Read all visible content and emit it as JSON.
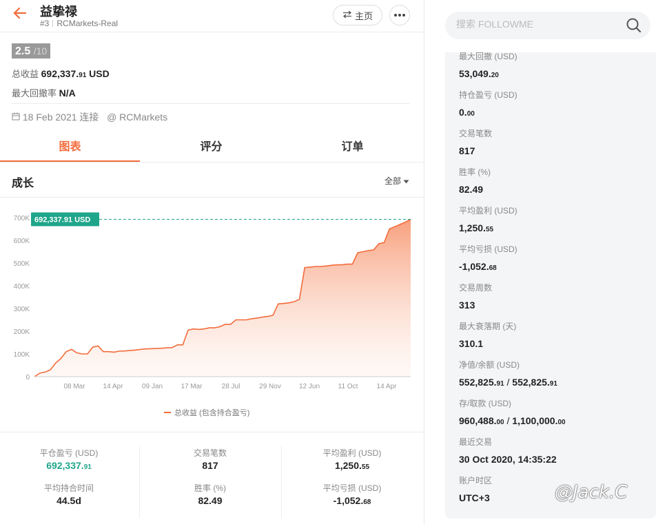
{
  "header": {
    "back_icon": "arrow-left-icon",
    "trader_name": "益挚禄",
    "rank": "#3",
    "broker_account": "RCMarkets-Real",
    "home_button": "主页",
    "more_icon": "ellipsis-icon"
  },
  "summary": {
    "score": "2.5",
    "score_denominator": "/10",
    "total_profit_label": "总收益",
    "total_profit_int": "692,337.",
    "total_profit_dec": "91",
    "total_profit_unit": "USD",
    "max_drawdown_label": "最大回撤率",
    "max_drawdown_value": "N/A",
    "connected_date": "18 Feb 2021 连接",
    "connected_broker": "@ RCMarkets"
  },
  "tabs": [
    {
      "label": "图表",
      "active": true
    },
    {
      "label": "评分",
      "active": false
    },
    {
      "label": "订单",
      "active": false
    }
  ],
  "growth": {
    "title": "成长",
    "range": "全部"
  },
  "chart_data": {
    "type": "area",
    "title": "",
    "xlabel": "",
    "ylabel": "",
    "ylim": [
      0,
      700000
    ],
    "yticks": [
      "0",
      "100K",
      "200K",
      "300K",
      "400K",
      "500K",
      "600K",
      "700K"
    ],
    "xticks": [
      "08 Mar",
      "14 Apr",
      "09 Jan",
      "17 Mar",
      "28 Jul",
      "29 Nov",
      "12 Jun",
      "11 Oct",
      "14 Apr"
    ],
    "current_label": "692,337.91 USD",
    "series": [
      {
        "name": "总收益 (包含持合盈亏)",
        "color": "#f26b3a",
        "values": [
          0,
          15000,
          20000,
          30000,
          60000,
          80000,
          110000,
          120000,
          105000,
          100000,
          100000,
          130000,
          135000,
          110000,
          110000,
          108000,
          112000,
          113000,
          115000,
          117000,
          120000,
          122000,
          123000,
          124000,
          125000,
          127000,
          128000,
          140000,
          140000,
          205000,
          210000,
          208000,
          210000,
          215000,
          215000,
          220000,
          230000,
          230000,
          250000,
          250000,
          250000,
          255000,
          258000,
          262000,
          265000,
          270000,
          320000,
          322000,
          325000,
          330000,
          340000,
          480000,
          482000,
          485000,
          485000,
          487000,
          490000,
          492000,
          492000,
          495000,
          495000,
          545000,
          550000,
          555000,
          558000,
          585000,
          590000,
          650000,
          660000,
          670000,
          680000,
          692338
        ]
      }
    ],
    "legend": "bottom-center",
    "grid": false
  },
  "bottom_stats": [
    {
      "label": "平仓盈亏 (USD)",
      "int": "692,337.",
      "dec": "91",
      "green": true
    },
    {
      "label": "交易笔数",
      "int": "817",
      "dec": "",
      "green": false
    },
    {
      "label": "平均盈利 (USD)",
      "int": "1,250.",
      "dec": "55",
      "green": false
    },
    {
      "label": "平均持合时间",
      "int": "44.5d",
      "dec": "",
      "green": false
    },
    {
      "label": "胜率 (%)",
      "int": "82.49",
      "dec": "",
      "green": false
    },
    {
      "label": "平均亏损 (USD)",
      "int": "-1,052.",
      "dec": "68",
      "green": false
    }
  ],
  "search": {
    "placeholder": "搜索 FOLLOWME",
    "icon": "search-icon"
  },
  "right_panel": [
    {
      "label": "最大回撤 (USD)",
      "int": "53,049.",
      "dec": "20",
      "int2": "",
      "dec2": ""
    },
    {
      "label": "持仓盈亏 (USD)",
      "int": "0.",
      "dec": "00",
      "int2": "",
      "dec2": ""
    },
    {
      "label": "交易笔数",
      "int": "817",
      "dec": "",
      "int2": "",
      "dec2": ""
    },
    {
      "label": "胜率 (%)",
      "int": "82.49",
      "dec": "",
      "int2": "",
      "dec2": ""
    },
    {
      "label": "平均盈利 (USD)",
      "int": "1,250.",
      "dec": "55",
      "int2": "",
      "dec2": ""
    },
    {
      "label": "平均亏损 (USD)",
      "int": "-1,052.",
      "dec": "68",
      "int2": "",
      "dec2": ""
    },
    {
      "label": "交易周数",
      "int": "313",
      "dec": "",
      "int2": "",
      "dec2": ""
    },
    {
      "label": "最大衰落期 (天)",
      "int": "310.1",
      "dec": "",
      "int2": "",
      "dec2": ""
    },
    {
      "label": "净值/余额 (USD)",
      "int": "552,825.",
      "dec": "91",
      "int2": "552,825.",
      "dec2": "91"
    },
    {
      "label": "存/取款 (USD)",
      "int": "960,488.",
      "dec": "00",
      "int2": "1,100,000.",
      "dec2": "00"
    },
    {
      "label": "最近交易",
      "int": "30 Oct 2020, 14:35:22",
      "dec": "",
      "int2": "",
      "dec2": ""
    },
    {
      "label": "账户时区",
      "int": "UTC+3",
      "dec": "",
      "int2": "",
      "dec2": ""
    }
  ],
  "watermark": "@Jack.C"
}
